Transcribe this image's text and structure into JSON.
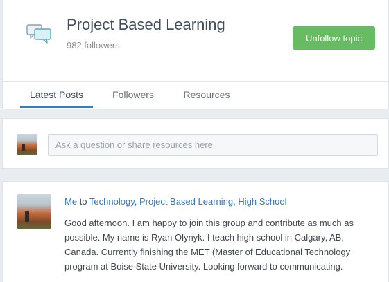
{
  "topic": {
    "title": "Project Based Learning",
    "followers": "982 followers",
    "unfollow_label": "Unfollow topic"
  },
  "tabs": [
    {
      "label": "Latest Posts",
      "active": true
    },
    {
      "label": "Followers",
      "active": false
    },
    {
      "label": "Resources",
      "active": false
    }
  ],
  "composer": {
    "placeholder": "Ask a question or share resources here"
  },
  "post": {
    "author": "Me",
    "to_word": "to",
    "sep1": ",",
    "sep2": ",",
    "topics": [
      "Technology",
      "Project Based Learning",
      "High School"
    ],
    "body": "Good afternoon. I am happy to join this group and contribute as much as possible. My name is Ryan Olynyk. I teach high school in Calgary, AB, Canada. Currently finishing the MET (Master of Educational Technology program at Boise State University. Looking forward to communicating."
  },
  "colors": {
    "accent": "#2f7dc3",
    "button_green": "#66bb63",
    "background": "#e9edf1"
  },
  "icons": {
    "topic": "chat-bubbles-icon"
  }
}
